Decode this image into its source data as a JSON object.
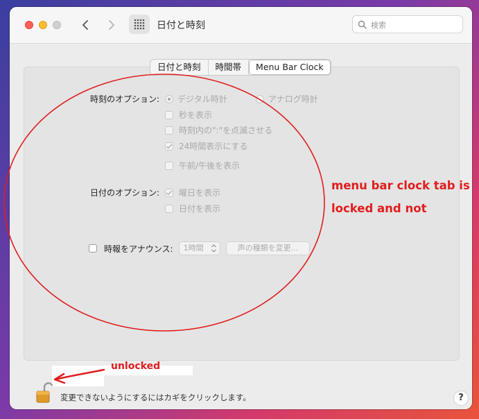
{
  "window": {
    "title": "日付と時刻"
  },
  "search": {
    "placeholder": "検索"
  },
  "tabs": [
    {
      "label": "日付と時刻"
    },
    {
      "label": "時間帯"
    },
    {
      "label": "Menu Bar Clock"
    }
  ],
  "time_options": {
    "label": "時刻のオプション:",
    "radio_digital": "デジタル時計",
    "radio_analog": "アナログ時計",
    "show_seconds": "秒を表示",
    "flash_separators": "時刻内の\":\"を点滅させる",
    "use_24h": "24時間表示にする",
    "show_ampm": "午前/午後を表示"
  },
  "date_options": {
    "label": "日付のオプション:",
    "show_weekday": "曜日を表示",
    "show_date": "日付を表示"
  },
  "announce": {
    "label": "時報をアナウンス:",
    "interval": "1時間",
    "voice_button": "声の種類を変更..."
  },
  "footer": {
    "lock_text": "変更できないようにするにはカギをクリックします。",
    "help": "?"
  },
  "annotations": {
    "note_line1": "menu bar clock tab is",
    "note_line2": "locked and not",
    "unlocked": "unlocked",
    "color": "#e01d1d"
  }
}
